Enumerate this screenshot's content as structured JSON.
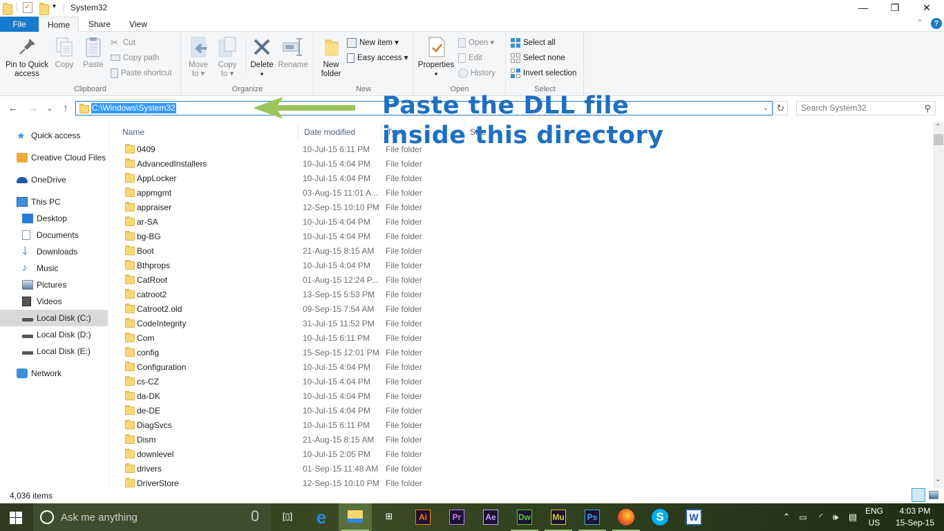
{
  "window": {
    "title": "System32",
    "controls": {
      "minimize": "—",
      "maximize": "❐",
      "close": "✕"
    }
  },
  "ribbon_tabs": [
    {
      "label": "File"
    },
    {
      "label": "Home",
      "active": true
    },
    {
      "label": "Share"
    },
    {
      "label": "View"
    }
  ],
  "ribbon": {
    "clipboard": {
      "label": "Clipboard",
      "pin": "Pin to Quick access",
      "pin_line1": "Pin to Quick",
      "pin_line2": "access",
      "copy": "Copy",
      "paste": "Paste",
      "cut": "Cut",
      "copy_path": "Copy path",
      "paste_shortcut": "Paste shortcut"
    },
    "organize": {
      "label": "Organize",
      "move_to_line1": "Move",
      "move_to_line2": "to ▾",
      "copy_to_line1": "Copy",
      "copy_to_line2": "to ▾",
      "delete": "Delete",
      "delete_arrow": "▾",
      "rename": "Rename"
    },
    "new": {
      "label": "New",
      "new_folder_line1": "New",
      "new_folder_line2": "folder",
      "new_item": "New item ▾",
      "easy_access": "Easy access ▾"
    },
    "open": {
      "label": "Open",
      "properties": "Properties",
      "properties_arrow": "▾",
      "open": "Open ▾",
      "edit": "Edit",
      "history": "History"
    },
    "select": {
      "label": "Select",
      "select_all": "Select all",
      "select_none": "Select none",
      "invert_selection": "Invert selection"
    }
  },
  "navigation": {
    "back": "←",
    "forward": "→",
    "recent": "⌄",
    "up": "↑",
    "address": "C:\\Windows\\System32",
    "refresh": "↻",
    "search_placeholder": "Search System32"
  },
  "annotation": {
    "line1": "Paste the DLL file",
    "line2": "inside this directory",
    "color": "#1e6fc0",
    "arrow_color": "#9bc45a"
  },
  "nav_pane": [
    {
      "label": "Quick access",
      "icon": "star-icon"
    },
    {
      "label": "Creative Cloud Files",
      "icon": "creative-cloud-icon"
    },
    {
      "label": "OneDrive",
      "icon": "onedrive-icon"
    },
    {
      "label": "This PC",
      "icon": "computer-icon"
    },
    {
      "label": "Desktop",
      "icon": "desktop-icon"
    },
    {
      "label": "Documents",
      "icon": "documents-icon"
    },
    {
      "label": "Downloads",
      "icon": "downloads-icon"
    },
    {
      "label": "Music",
      "icon": "music-icon"
    },
    {
      "label": "Pictures",
      "icon": "pictures-icon"
    },
    {
      "label": "Videos",
      "icon": "videos-icon"
    },
    {
      "label": "Local Disk (C:)",
      "icon": "drive-icon",
      "selected": true
    },
    {
      "label": "Local Disk (D:)",
      "icon": "drive-icon"
    },
    {
      "label": "Local Disk (E:)",
      "icon": "drive-icon"
    },
    {
      "label": "Network",
      "icon": "network-icon"
    }
  ],
  "columns": {
    "name": "Name",
    "date": "Date modified",
    "type": "Type",
    "size": "Size"
  },
  "files": [
    {
      "name": "0409",
      "date": "10-Jul-15 6:11 PM",
      "type": "File folder"
    },
    {
      "name": "AdvancedInstallers",
      "date": "10-Jul-15 4:04 PM",
      "type": "File folder"
    },
    {
      "name": "AppLocker",
      "date": "10-Jul-15 4:04 PM",
      "type": "File folder"
    },
    {
      "name": "appmgmt",
      "date": "03-Aug-15 11:01 A...",
      "type": "File folder"
    },
    {
      "name": "appraiser",
      "date": "12-Sep-15 10:10 PM",
      "type": "File folder"
    },
    {
      "name": "ar-SA",
      "date": "10-Jul-15 4:04 PM",
      "type": "File folder"
    },
    {
      "name": "bg-BG",
      "date": "10-Jul-15 4:04 PM",
      "type": "File folder"
    },
    {
      "name": "Boot",
      "date": "21-Aug-15 8:15 AM",
      "type": "File folder"
    },
    {
      "name": "Bthprops",
      "date": "10-Jul-15 4:04 PM",
      "type": "File folder"
    },
    {
      "name": "CatRoot",
      "date": "01-Aug-15 12:24 P...",
      "type": "File folder"
    },
    {
      "name": "catroot2",
      "date": "13-Sep-15 5:53 PM",
      "type": "File folder"
    },
    {
      "name": "Catroot2.old",
      "date": "09-Sep-15 7:54 AM",
      "type": "File folder"
    },
    {
      "name": "CodeIntegrity",
      "date": "31-Jul-15 11:52 PM",
      "type": "File folder"
    },
    {
      "name": "Com",
      "date": "10-Jul-15 6:11 PM",
      "type": "File folder"
    },
    {
      "name": "config",
      "date": "15-Sep-15 12:01 PM",
      "type": "File folder"
    },
    {
      "name": "Configuration",
      "date": "10-Jul-15 4:04 PM",
      "type": "File folder"
    },
    {
      "name": "cs-CZ",
      "date": "10-Jul-15 4:04 PM",
      "type": "File folder"
    },
    {
      "name": "da-DK",
      "date": "10-Jul-15 4:04 PM",
      "type": "File folder"
    },
    {
      "name": "de-DE",
      "date": "10-Jul-15 4:04 PM",
      "type": "File folder"
    },
    {
      "name": "DiagSvcs",
      "date": "10-Jul-15 6:11 PM",
      "type": "File folder"
    },
    {
      "name": "Dism",
      "date": "21-Aug-15 8:15 AM",
      "type": "File folder"
    },
    {
      "name": "downlevel",
      "date": "10-Jul-15 2:05 PM",
      "type": "File folder"
    },
    {
      "name": "drivers",
      "date": "01-Sep-15 11:48 AM",
      "type": "File folder"
    },
    {
      "name": "DriverStore",
      "date": "12-Sep-15 10:10 PM",
      "type": "File folder"
    }
  ],
  "status": {
    "item_count": "4,036 items"
  },
  "taskbar": {
    "search_placeholder": "Ask me anything",
    "apps": [
      {
        "name": "task-view",
        "label": "[▯]"
      },
      {
        "name": "edge",
        "label": "e"
      },
      {
        "name": "file-explorer",
        "label": ""
      },
      {
        "name": "store",
        "label": "⊞"
      },
      {
        "name": "illustrator",
        "label": "Ai",
        "color": "#ff7c00"
      },
      {
        "name": "premiere",
        "label": "Pr",
        "color": "#c87bff"
      },
      {
        "name": "after-effects",
        "label": "Ae",
        "color": "#c0a0ff"
      },
      {
        "name": "dreamweaver",
        "label": "Dw",
        "color": "#4ad31f"
      },
      {
        "name": "muse",
        "label": "Mu",
        "color": "#d4d21e"
      },
      {
        "name": "photoshop",
        "label": "Ps",
        "color": "#31a8ff"
      },
      {
        "name": "firefox",
        "label": ""
      },
      {
        "name": "skype",
        "label": "S"
      },
      {
        "name": "word",
        "label": "W"
      }
    ],
    "tray": {
      "language_top": "ENG",
      "language_bottom": "US",
      "time": "4:03 PM",
      "date": "15-Sep-15"
    }
  }
}
